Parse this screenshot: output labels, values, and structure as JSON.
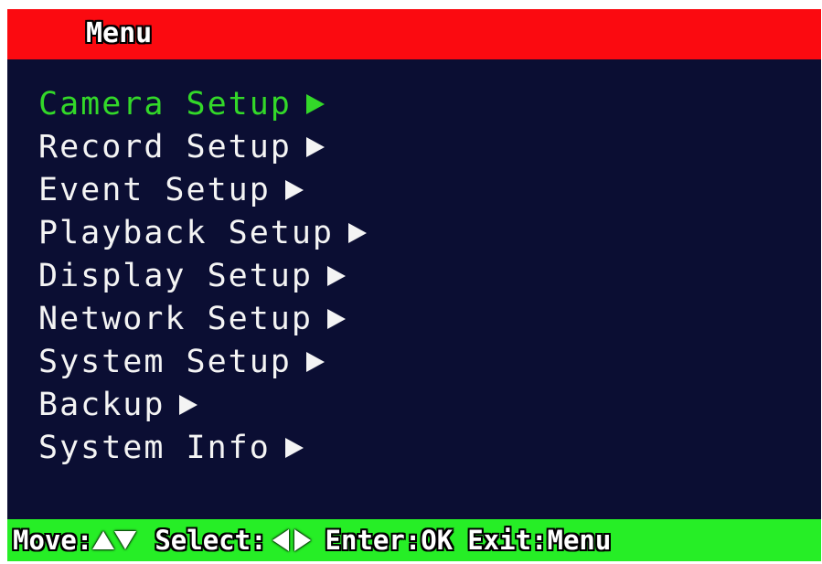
{
  "title": "Menu",
  "menu": {
    "items": [
      {
        "label": "Camera Setup",
        "selected": true
      },
      {
        "label": "Record Setup",
        "selected": false
      },
      {
        "label": "Event Setup",
        "selected": false
      },
      {
        "label": "Playback Setup",
        "selected": false
      },
      {
        "label": "Display Setup",
        "selected": false
      },
      {
        "label": "Network Setup",
        "selected": false
      },
      {
        "label": "System Setup",
        "selected": false
      },
      {
        "label": "Backup",
        "selected": false
      },
      {
        "label": "System Info",
        "selected": false
      }
    ],
    "arrow_icon": "right-triangle-icon"
  },
  "footer": {
    "move_label": "Move:",
    "move_icons": [
      "up-triangle-icon",
      "down-triangle-icon"
    ],
    "select_label": "Select:",
    "select_icons": [
      "left-triangle-icon",
      "right-triangle-icon"
    ],
    "enter_label": "Enter:OK",
    "exit_label": "Exit:Menu"
  },
  "colors": {
    "title_bar": "#fb0a10",
    "background": "#0b0e33",
    "status_bar": "#26ee26",
    "selected_text": "#33d829",
    "normal_text": "#f4f4f4"
  }
}
